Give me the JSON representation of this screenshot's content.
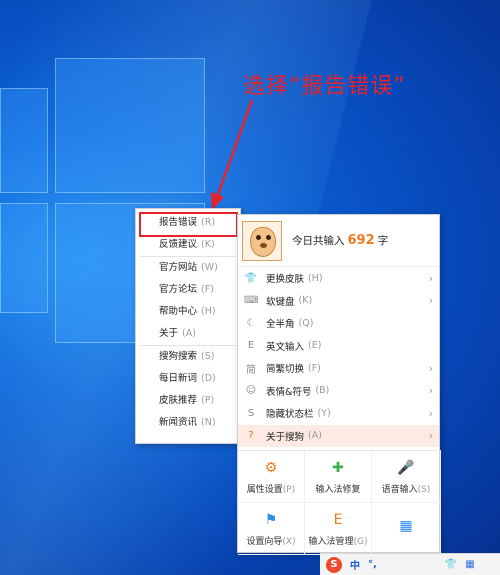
{
  "annotation": {
    "text": "选择“报告错误”",
    "color": "#e8222a"
  },
  "left_menu": {
    "groups": [
      [
        {
          "label": "报告错误",
          "key": "(R)"
        },
        {
          "label": "反馈建议",
          "key": "(K)"
        }
      ],
      [
        {
          "label": "官方网站",
          "key": "(W)"
        },
        {
          "label": "官方论坛",
          "key": "(F)"
        },
        {
          "label": "帮助中心",
          "key": "(H)"
        },
        {
          "label": "关于",
          "key": "(A)"
        }
      ],
      [
        {
          "label": "搜狗搜索",
          "key": "(S)"
        },
        {
          "label": "每日新词",
          "key": "(D)"
        },
        {
          "label": "皮肤推荐",
          "key": "(P)"
        },
        {
          "label": "新闻资讯",
          "key": "(N)"
        }
      ]
    ]
  },
  "right_menu": {
    "header": {
      "label": "今日共输入",
      "count": "692",
      "unit": "字"
    },
    "items": [
      {
        "label": "更换皮肤",
        "key": "(H)",
        "icon": "shirt-icon",
        "glyph": "👕",
        "submenu": true
      },
      {
        "label": "软键盘",
        "key": "(K)",
        "icon": "keyboard-icon",
        "glyph": "⌨",
        "submenu": true
      },
      {
        "label": "全半角",
        "key": "(Q)",
        "icon": "moon-icon",
        "glyph": "☾",
        "submenu": false
      },
      {
        "label": "英文输入",
        "key": "(E)",
        "icon": "english-icon",
        "glyph": "E",
        "submenu": false
      },
      {
        "label": "简繁切换",
        "key": "(F)",
        "icon": "simplified-traditional-icon",
        "glyph": "简",
        "submenu": true
      },
      {
        "label": "表情&符号",
        "key": "(B)",
        "icon": "emoji-icon",
        "glyph": "☺",
        "submenu": true
      },
      {
        "label": "隐藏状态栏",
        "key": "(Y)",
        "icon": "hide-statusbar-icon",
        "glyph": "S",
        "submenu": true
      },
      {
        "label": "关于搜狗",
        "key": "(A)",
        "icon": "help-circle-icon",
        "glyph": "?",
        "submenu": true,
        "active": true
      }
    ],
    "tools": [
      {
        "label": "属性设置",
        "key": "(P)",
        "icon": "gear-icon",
        "glyph": "⚙",
        "color": "#f07a1e"
      },
      {
        "label": "输入法修复",
        "key": "",
        "icon": "repair-icon",
        "glyph": "✚",
        "color": "#3db04a"
      },
      {
        "label": "语音输入",
        "key": "(S)",
        "icon": "microphone-icon",
        "glyph": "🎤",
        "color": "#2f8be8"
      },
      {
        "label": "设置向导",
        "key": "(X)",
        "icon": "flag-icon",
        "glyph": "⚑",
        "color": "#2f8be8"
      },
      {
        "label": "输入法管理",
        "key": "(G)",
        "icon": "manager-icon",
        "glyph": "E",
        "color": "#f07a1e"
      },
      {
        "label": "",
        "key": "",
        "icon": "apps-grid-icon",
        "glyph": "▦",
        "color": "#2f8be8"
      }
    ]
  },
  "taskbar": {
    "logo": "S",
    "mode": "中",
    "punct": "°,",
    "icons": [
      "shirt-icon",
      "grid-icon"
    ]
  }
}
